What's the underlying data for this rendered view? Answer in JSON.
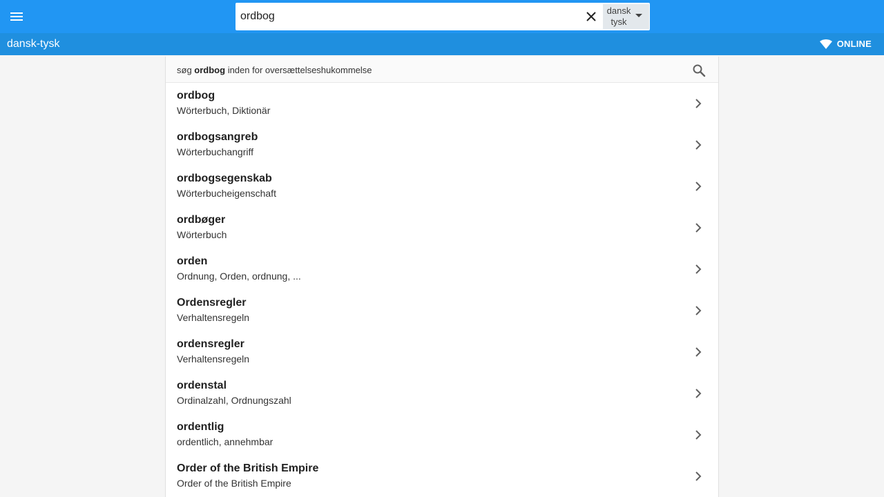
{
  "header": {
    "search_value": "ordbog",
    "lang_from": "dansk",
    "lang_to": "tysk"
  },
  "subheader": {
    "title": "dansk-tysk",
    "status": "ONLINE"
  },
  "memory_search": {
    "prefix": "søg",
    "term": "ordbog",
    "suffix": "inden for oversættelseshukommelse"
  },
  "results": [
    {
      "term": "ordbog",
      "translation": "Wörterbuch, Diktionär"
    },
    {
      "term": "ordbogsangreb",
      "translation": "Wörterbuchangriff"
    },
    {
      "term": "ordbogsegenskab",
      "translation": "Wörterbucheigenschaft"
    },
    {
      "term": "ordbøger",
      "translation": "Wörterbuch"
    },
    {
      "term": "orden",
      "translation": "Ordnung, Orden, ordnung, ..."
    },
    {
      "term": "Ordensregler",
      "translation": "Verhaltensregeln"
    },
    {
      "term": "ordensregler",
      "translation": "Verhaltensregeln"
    },
    {
      "term": "ordenstal",
      "translation": "Ordinalzahl, Ordnungszahl"
    },
    {
      "term": "ordentlig",
      "translation": "ordentlich, annehmbar"
    },
    {
      "term": "Order of the British Empire",
      "translation": "Order of the British Empire"
    }
  ],
  "icons": {
    "menu": "menu-icon",
    "clear": "close-icon",
    "dropdown": "caret-down-icon",
    "wifi": "wifi-icon",
    "search": "search-icon",
    "chevron": "chevron-right-icon"
  },
  "colors": {
    "primary": "#2196f3",
    "subbar": "#1f8fdf"
  }
}
